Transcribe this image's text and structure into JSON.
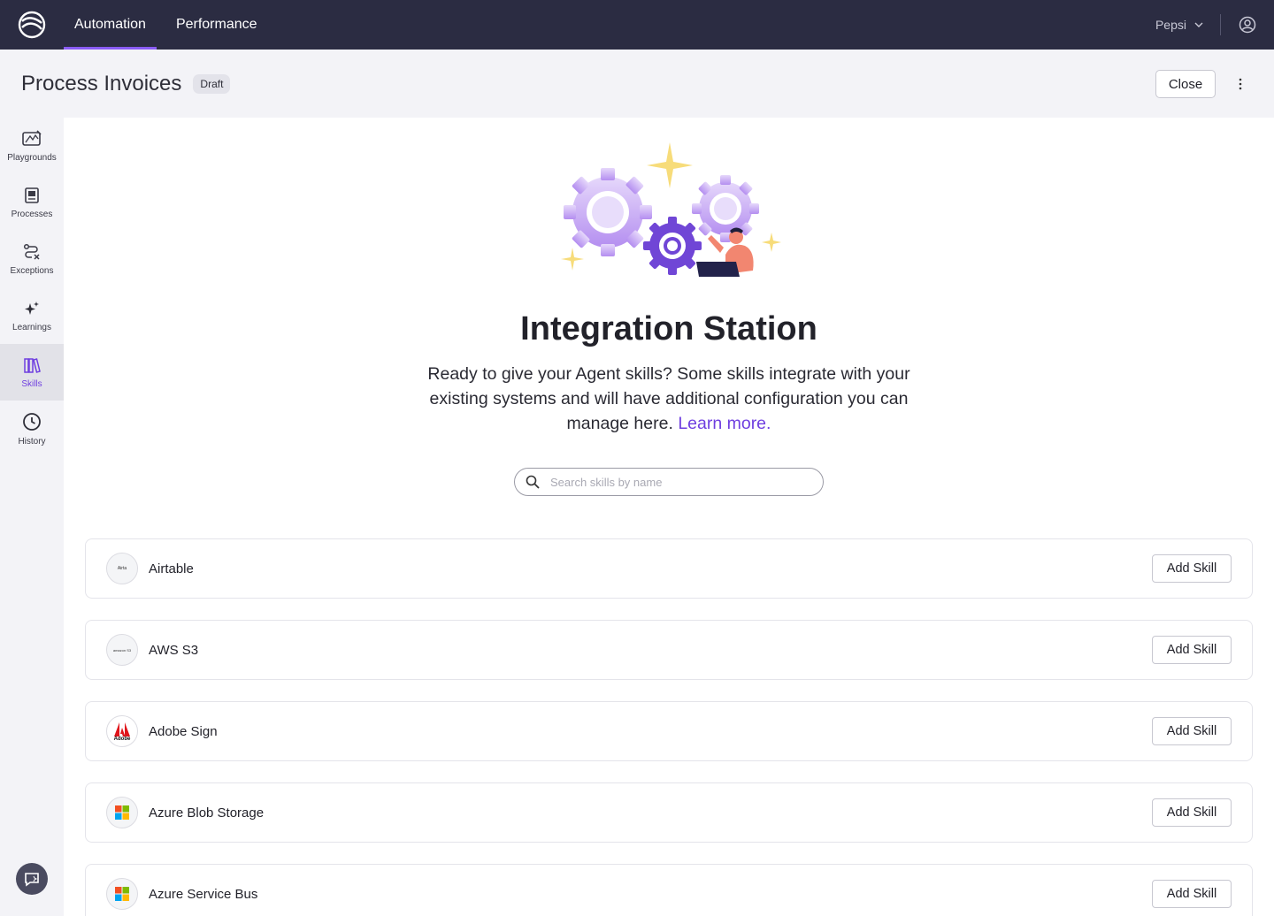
{
  "nav": {
    "tabs": [
      {
        "label": "Automation"
      },
      {
        "label": "Performance"
      }
    ],
    "org": "Pepsi"
  },
  "header": {
    "title": "Process Invoices",
    "badge": "Draft",
    "close_label": "Close"
  },
  "sidebar": {
    "items": [
      {
        "label": "Playgrounds",
        "icon": "playground-icon"
      },
      {
        "label": "Processes",
        "icon": "processes-icon"
      },
      {
        "label": "Exceptions",
        "icon": "exceptions-icon"
      },
      {
        "label": "Learnings",
        "icon": "sparkles-icon"
      },
      {
        "label": "Skills",
        "icon": "books-icon"
      },
      {
        "label": "History",
        "icon": "clock-icon"
      }
    ],
    "active": "Skills"
  },
  "main": {
    "title": "Integration Station",
    "description": "Ready to give your Agent skills?  Some skills integrate with your existing systems and will have additional configuration you can manage here.",
    "learn_more": "Learn more.",
    "search_placeholder": "Search skills by name",
    "add_label": "Add Skill",
    "skills": [
      {
        "name": "Airtable",
        "logo_text": "Airta"
      },
      {
        "name": "AWS S3",
        "logo_text": "amazon S3"
      },
      {
        "name": "Adobe Sign",
        "logo_text": "Adobe"
      },
      {
        "name": "Azure Blob Storage",
        "logo_text": ""
      },
      {
        "name": "Azure Service Bus",
        "logo_text": ""
      }
    ]
  },
  "colors": {
    "topbar": "#2b2c42",
    "accent": "#6f3fe0",
    "sidebar_active": "#e2e2e8"
  }
}
